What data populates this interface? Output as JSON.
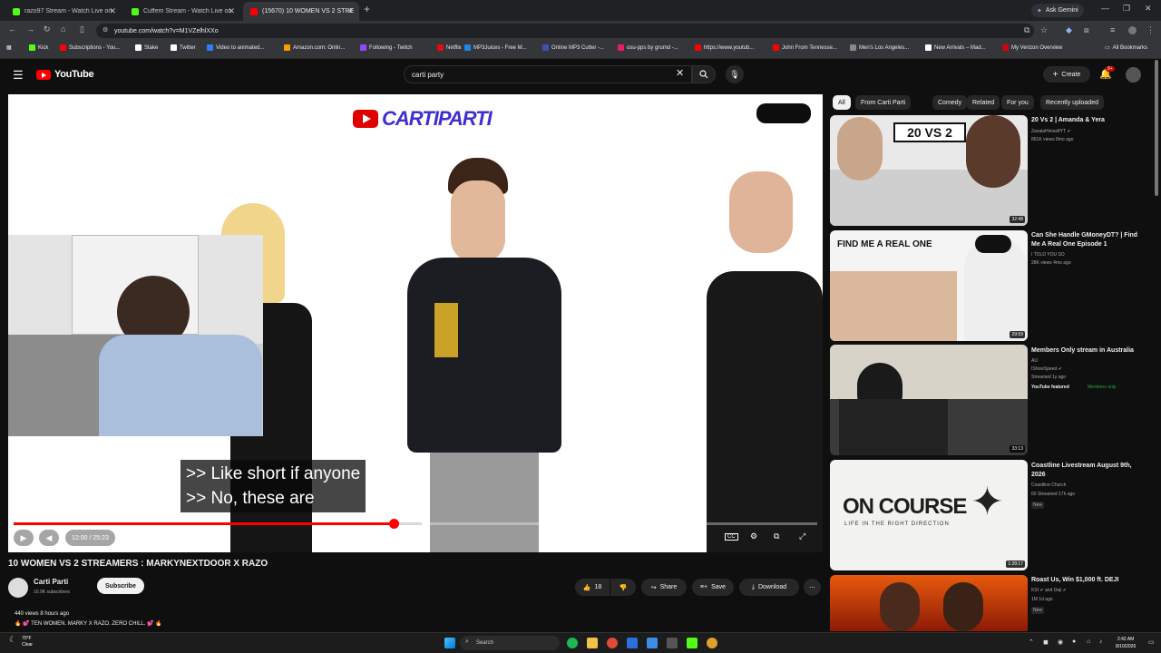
{
  "browser": {
    "tabs": [
      {
        "title": "razo97 Stream - Watch Live on",
        "favicon_color": "#53fc18",
        "active": false
      },
      {
        "title": "Cuffem Stream - Watch Live on",
        "favicon_color": "#53fc18",
        "active": false
      },
      {
        "title": "(15670) 10 WOMEN VS 2 STRE",
        "favicon_color": "#ff0000",
        "active": true
      }
    ],
    "ask_gemini": "Ask Gemini",
    "url": "youtube.com/watch?v=M1VZelhlXXo",
    "bookmarks": [
      {
        "label": "Kick",
        "color": "#53fc18"
      },
      {
        "label": "Subscriptions - You...",
        "color": "#ff0000"
      },
      {
        "label": "Stake",
        "color": "#ffffff"
      },
      {
        "label": "Twitter",
        "color": "#ffffff"
      },
      {
        "label": "Video to animated...",
        "color": "#2d7ff9"
      },
      {
        "label": "Amazon.com: Onlin...",
        "color": "#ff9900"
      },
      {
        "label": "Following - Twitch",
        "color": "#9146ff"
      },
      {
        "label": "Netflix",
        "color": "#e50914"
      },
      {
        "label": "MP3Juices - Free M...",
        "color": "#1e88e5"
      },
      {
        "label": "Online MP3 Cutter -...",
        "color": "#3f51b5"
      },
      {
        "label": "osu-pps by grumd -...",
        "color": "#e91e63"
      },
      {
        "label": "https://www.youtub...",
        "color": "#ff0000"
      },
      {
        "label": "John From Tennesse...",
        "color": "#ff0000"
      },
      {
        "label": "Men's Los Angeles...",
        "color": "#888888"
      },
      {
        "label": "New Arrivals – Mad...",
        "color": "#ffffff"
      },
      {
        "label": "My Verizon Overview",
        "color": "#cd040b"
      }
    ],
    "all_bookmarks": "All Bookmarks"
  },
  "youtube": {
    "logo_text": "YouTube",
    "search_value": "carti party",
    "create_label": "Create",
    "notification_count": "9+"
  },
  "player": {
    "brand_text": "CARTIPARTI",
    "captions": [
      ">> Like short if anyone",
      ">> No, these are"
    ],
    "time": "12:00 / 25:23",
    "progress_fraction": 0.473
  },
  "video": {
    "title": "10 WOMEN VS 2 STREAMERS : MARKYNEXTDOOR X RAZO",
    "channel": "Carti Parti",
    "subscribers": "10.9K subscribers",
    "subscribe_label": "Subscribe",
    "likes": "18",
    "share_label": "Share",
    "save_label": "Save",
    "download_label": "Download",
    "stats": "440 views  8 hours ago",
    "description": "🔥 💕 TEN WOMEN. MARKY X RAZO. ZERO CHILL. 💕 🔥"
  },
  "sidebar": {
    "chips": [
      "All",
      "From Carti Parti",
      "Comedy",
      "Related",
      "For you",
      "Recently uploaded"
    ],
    "videos": [
      {
        "title": "20 Vs 2 | Amanda & Yera",
        "channel": "ZavalaHimselfYT ✔",
        "meta": "861K views  8mo ago",
        "duration": "32:48",
        "badge": "",
        "thumb_bg": "#e9e9e9",
        "thumb_text": "20 VS 2"
      },
      {
        "title": "Can She Handle GMoneyDT? | Find Me A Real One Episode 1",
        "channel": "I TOLD YOU SO",
        "meta": "28K views  4mo ago",
        "duration": "29:59",
        "badge": "",
        "thumb_bg": "#f4f4f4",
        "thumb_text": "FIND ME A REAL ONE"
      },
      {
        "title": "Members Only stream in Australia",
        "channel": "AU",
        "meta": "IShowSpeed ✔",
        "meta2": "Streamed 1y ago",
        "featured": "YouTube featured",
        "members": "Members only",
        "duration": "33:13",
        "badge": "",
        "thumb_bg": "#3a3a3a",
        "thumb_text": ""
      },
      {
        "title": "Coastline Livestream August 9th, 2026",
        "channel": "Coastline Church",
        "meta": "60  Streamed 17h ago",
        "duration": "1:28:17",
        "badge": "New",
        "thumb_bg": "#f2f2ee",
        "thumb_text": "ON COURSE"
      },
      {
        "title": "Roast Us, Win $1,000 ft. DEJI",
        "channel": "KSI ✔ and Deji ✔",
        "meta": "1M  1d ago",
        "duration": "",
        "badge": "New",
        "thumb_bg": "#c0300a",
        "thumb_text": ""
      }
    ],
    "thumb_subtext_on_course": "LIFE IN THE RIGHT DIRECTION"
  },
  "taskbar": {
    "weather_temp": "70°F",
    "weather_desc": "Clear",
    "search_label": "Search",
    "time": "2:42 AM",
    "date": "8/10/2026"
  }
}
